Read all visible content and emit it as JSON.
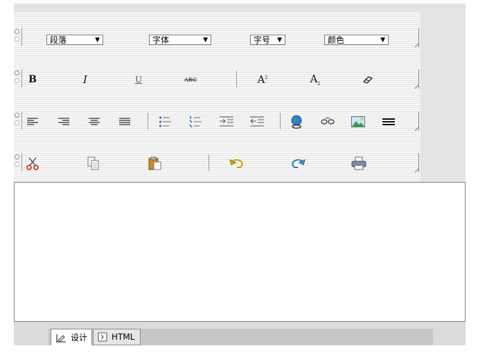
{
  "toolbar": {
    "row1": {
      "selects": [
        {
          "id": "paragraph",
          "value": "段落"
        },
        {
          "id": "font",
          "value": "字体"
        },
        {
          "id": "size",
          "value": "字号"
        },
        {
          "id": "color",
          "value": "颜色"
        }
      ]
    },
    "row2": {
      "bold_label": "B",
      "italic_label": "I",
      "underline_label": "U",
      "strike_label": "ABC",
      "superscript_base": "A",
      "superscript_mark": "2",
      "subscript_base": "A",
      "subscript_mark": "2"
    },
    "row3_icons": [
      "align-left-icon",
      "align-right-icon",
      "align-center-icon",
      "align-justify-icon",
      "bulleted-list-icon",
      "numbered-list-icon",
      "indent-icon",
      "outdent-icon",
      "insert-link-icon",
      "unlink-icon",
      "insert-image-icon",
      "horizontal-rule-icon"
    ],
    "row4_icons": [
      "cut-icon",
      "copy-icon",
      "paste-icon",
      "undo-icon",
      "redo-icon",
      "print-icon"
    ]
  },
  "editor": {
    "content": ""
  },
  "tabs": [
    {
      "label": "设计",
      "icon": "design-icon",
      "active": true
    },
    {
      "label": "HTML",
      "icon": "html-icon",
      "active": false
    }
  ]
}
